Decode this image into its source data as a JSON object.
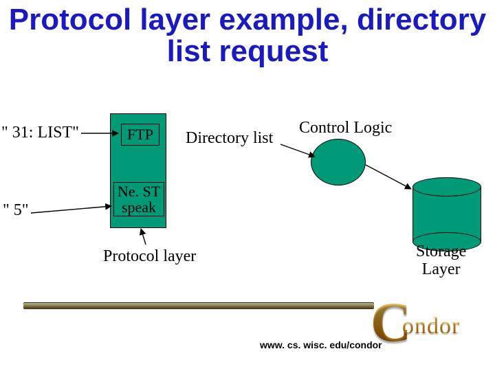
{
  "title": "Protocol layer example, directory list request",
  "labels": {
    "input31": "\" 31: LIST\"",
    "input5": "\" 5\"",
    "ftp": "FTP",
    "nest_line1": "Ne. ST",
    "nest_line2": "speak",
    "directory_list": "Directory list",
    "control_logic": "Control Logic",
    "protocol_layer": "Protocol layer",
    "storage_line1": "Storage",
    "storage_line2": "Layer"
  },
  "footer": {
    "url": "www. cs. wisc. edu/condor",
    "logo_big_c": "C",
    "logo_word": "ondor"
  },
  "colors": {
    "title": "#1a1abf",
    "shape_fill": "#009a78"
  }
}
